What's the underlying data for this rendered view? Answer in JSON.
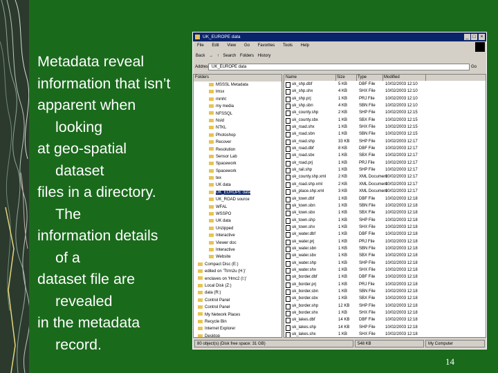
{
  "slide": {
    "body_lines": [
      {
        "text": "Metadata reveal",
        "indent": false
      },
      {
        "text": "information that isn’t",
        "indent": false
      },
      {
        "text": "apparent when",
        "indent": false
      },
      {
        "text": "looking",
        "indent": true
      },
      {
        "text": "at geo-spatial",
        "indent": false
      },
      {
        "text": "dataset",
        "indent": true
      },
      {
        "text": "files in a directory.",
        "indent": false
      },
      {
        "text": "The",
        "indent": true
      },
      {
        "text": "information details",
        "indent": false
      },
      {
        "text": "of a",
        "indent": true
      },
      {
        "text": "dataset file are",
        "indent": false
      },
      {
        "text": "revealed",
        "indent": true
      },
      {
        "text": "in the metadata",
        "indent": false
      },
      {
        "text": "record.",
        "indent": true
      }
    ],
    "page_number": "14",
    "colors": {
      "background": "#1a6a1c",
      "text": "#ffffff"
    }
  },
  "explorer": {
    "title": "UK_EUROPE data",
    "controls": [
      "_",
      "□",
      "×"
    ],
    "menu": [
      "File",
      "Edit",
      "View",
      "Go",
      "Favorites",
      "Tools",
      "Help"
    ],
    "toolbar": [
      "Back",
      "→",
      "↑",
      "Search",
      "Folders",
      "History"
    ],
    "address_label": "Address",
    "address_value": "UK_EUROPE data",
    "go_label": "Go",
    "tree_header": "Folders",
    "tree": [
      {
        "label": "MSSSL Metadata",
        "selected": false
      },
      {
        "label": "lmsx",
        "selected": false
      },
      {
        "label": "mmht",
        "selected": false
      },
      {
        "label": "my media",
        "selected": false
      },
      {
        "label": "NFSSQL",
        "selected": false
      },
      {
        "label": "Nsld",
        "selected": false
      },
      {
        "label": "NTKL",
        "selected": false
      },
      {
        "label": "Photoshop",
        "selected": false
      },
      {
        "label": "Recover",
        "selected": false
      },
      {
        "label": "Resolution",
        "selected": false
      },
      {
        "label": "Sensor Lab",
        "selected": false
      },
      {
        "label": "Spacework",
        "selected": false
      },
      {
        "label": "Spacework",
        "selected": false
      },
      {
        "label": "tex",
        "selected": false
      },
      {
        "label": "UK data",
        "selected": false
      },
      {
        "label": "UK_EUROPE data",
        "selected": true
      },
      {
        "label": "UK_ROAD source",
        "selected": false
      },
      {
        "label": "WFAL",
        "selected": false
      },
      {
        "label": "WSSPO",
        "selected": false
      },
      {
        "label": "UK data",
        "selected": false
      },
      {
        "label": "Unzipped",
        "selected": false
      },
      {
        "label": "Interactive",
        "selected": false
      },
      {
        "label": "Viewer doc",
        "selected": false
      },
      {
        "label": "Interactive",
        "selected": false
      },
      {
        "label": "Website",
        "selected": false
      },
      {
        "label": "Compact Disc (E:)",
        "selected": false
      },
      {
        "label": "edited on 'Ttrm2u (H:)'",
        "selected": false
      },
      {
        "label": "enclaves on 'Hmc2 (I:)'",
        "selected": false
      },
      {
        "label": "Local Disk (Z:)",
        "selected": false
      },
      {
        "label": "data (R:)",
        "selected": false
      },
      {
        "label": "Control Panel",
        "selected": false
      },
      {
        "label": "Control Panel",
        "selected": false
      },
      {
        "label": "My Network Places",
        "selected": false
      },
      {
        "label": "Recycle Bin",
        "selected": false
      },
      {
        "label": "Internet Explorer",
        "selected": false
      },
      {
        "label": "Desktop",
        "selected": false
      }
    ],
    "columns": [
      "Name",
      "Size",
      "Type",
      "Modified"
    ],
    "files": [
      {
        "name": "uk_shp.dbf",
        "size": "5 KB",
        "type": "DBF File",
        "modified": "10/02/2003 12:10"
      },
      {
        "name": "uk_shp.shx",
        "size": "4 KB",
        "type": "SHX File",
        "modified": "10/02/2003 12:10"
      },
      {
        "name": "uk_shp.prj",
        "size": "1 KB",
        "type": "PRJ File",
        "modified": "10/02/2003 12:10"
      },
      {
        "name": "uk_shp.sbn",
        "size": "4 KB",
        "type": "SBN File",
        "modified": "10/02/2003 12:10"
      },
      {
        "name": "uk_county.shp",
        "size": "2 KB",
        "type": "SHP File",
        "modified": "10/02/2003 12:15"
      },
      {
        "name": "uk_county.sbx",
        "size": "1 KB",
        "type": "SBX File",
        "modified": "10/02/2003 12:15"
      },
      {
        "name": "uk_road.shx",
        "size": "1 KB",
        "type": "SHX File",
        "modified": "10/02/2003 12:15"
      },
      {
        "name": "uk_road.sbn",
        "size": "1 KB",
        "type": "SBN File",
        "modified": "10/02/2003 12:15"
      },
      {
        "name": "uk_road.shp",
        "size": "33 KB",
        "type": "SHP File",
        "modified": "10/02/2003 12:17"
      },
      {
        "name": "uk_road.dbf",
        "size": "8 KB",
        "type": "DBF File",
        "modified": "10/02/2003 12:17"
      },
      {
        "name": "uk_road.sbx",
        "size": "1 KB",
        "type": "SBX File",
        "modified": "10/02/2003 12:17"
      },
      {
        "name": "uk_road.prj",
        "size": "1 KB",
        "type": "PRJ File",
        "modified": "10/02/2003 12:17"
      },
      {
        "name": "uk_rail.shp",
        "size": "1 KB",
        "type": "SHP File",
        "modified": "10/02/2003 12:17"
      },
      {
        "name": "uk_county.shp.xml",
        "size": "2 KB",
        "type": "XML Document",
        "modified": "10/02/2003 12:17"
      },
      {
        "name": "uk_road.shp.xml",
        "size": "2 KB",
        "type": "XML Document",
        "modified": "10/02/2003 12:17"
      },
      {
        "name": "uk_place.shp.xml",
        "size": "3 KB",
        "type": "XML Document",
        "modified": "10/02/2003 12:17"
      },
      {
        "name": "uk_town.dbf",
        "size": "1 KB",
        "type": "DBF File",
        "modified": "10/02/2003 12:18"
      },
      {
        "name": "uk_town.sbn",
        "size": "1 KB",
        "type": "SBN File",
        "modified": "10/02/2003 12:18"
      },
      {
        "name": "uk_town.sbx",
        "size": "1 KB",
        "type": "SBX File",
        "modified": "10/02/2003 12:18"
      },
      {
        "name": "uk_town.shp",
        "size": "1 KB",
        "type": "SHP File",
        "modified": "10/02/2003 12:18"
      },
      {
        "name": "uk_town.shx",
        "size": "1 KB",
        "type": "SHX File",
        "modified": "10/02/2003 12:18"
      },
      {
        "name": "uk_water.dbf",
        "size": "1 KB",
        "type": "DBF File",
        "modified": "10/02/2003 12:18"
      },
      {
        "name": "uk_water.prj",
        "size": "1 KB",
        "type": "PRJ File",
        "modified": "10/02/2003 12:18"
      },
      {
        "name": "uk_water.sbn",
        "size": "1 KB",
        "type": "SBN File",
        "modified": "10/02/2003 12:18"
      },
      {
        "name": "uk_water.sbx",
        "size": "1 KB",
        "type": "SBX File",
        "modified": "10/02/2003 12:18"
      },
      {
        "name": "uk_water.shp",
        "size": "1 KB",
        "type": "SHP File",
        "modified": "10/02/2003 12:18"
      },
      {
        "name": "uk_water.shx",
        "size": "1 KB",
        "type": "SHX File",
        "modified": "10/02/2003 12:18"
      },
      {
        "name": "uk_border.dbf",
        "size": "1 KB",
        "type": "DBF File",
        "modified": "10/02/2003 12:18"
      },
      {
        "name": "uk_border.prj",
        "size": "1 KB",
        "type": "PRJ File",
        "modified": "10/02/2003 12:18"
      },
      {
        "name": "uk_border.sbn",
        "size": "1 KB",
        "type": "SBN File",
        "modified": "10/02/2003 12:18"
      },
      {
        "name": "uk_border.sbx",
        "size": "1 KB",
        "type": "SBX File",
        "modified": "10/02/2003 12:18"
      },
      {
        "name": "uk_border.shp",
        "size": "12 KB",
        "type": "SHP File",
        "modified": "10/02/2003 12:18"
      },
      {
        "name": "uk_border.shx",
        "size": "1 KB",
        "type": "SHX File",
        "modified": "10/02/2003 12:18"
      },
      {
        "name": "uk_lakes.dbf",
        "size": "14 KB",
        "type": "DBF File",
        "modified": "10/02/2003 12:18"
      },
      {
        "name": "uk_lakes.shp",
        "size": "14 KB",
        "type": "SHP File",
        "modified": "10/02/2003 12:18"
      },
      {
        "name": "uk_lakes.shx",
        "size": "1 KB",
        "type": "SHX File",
        "modified": "10/02/2003 12:18"
      }
    ],
    "status_left": "80 object(s) (Disk free space: 31 GB)",
    "status_mid": "548 KB",
    "status_right": "My Computer"
  }
}
